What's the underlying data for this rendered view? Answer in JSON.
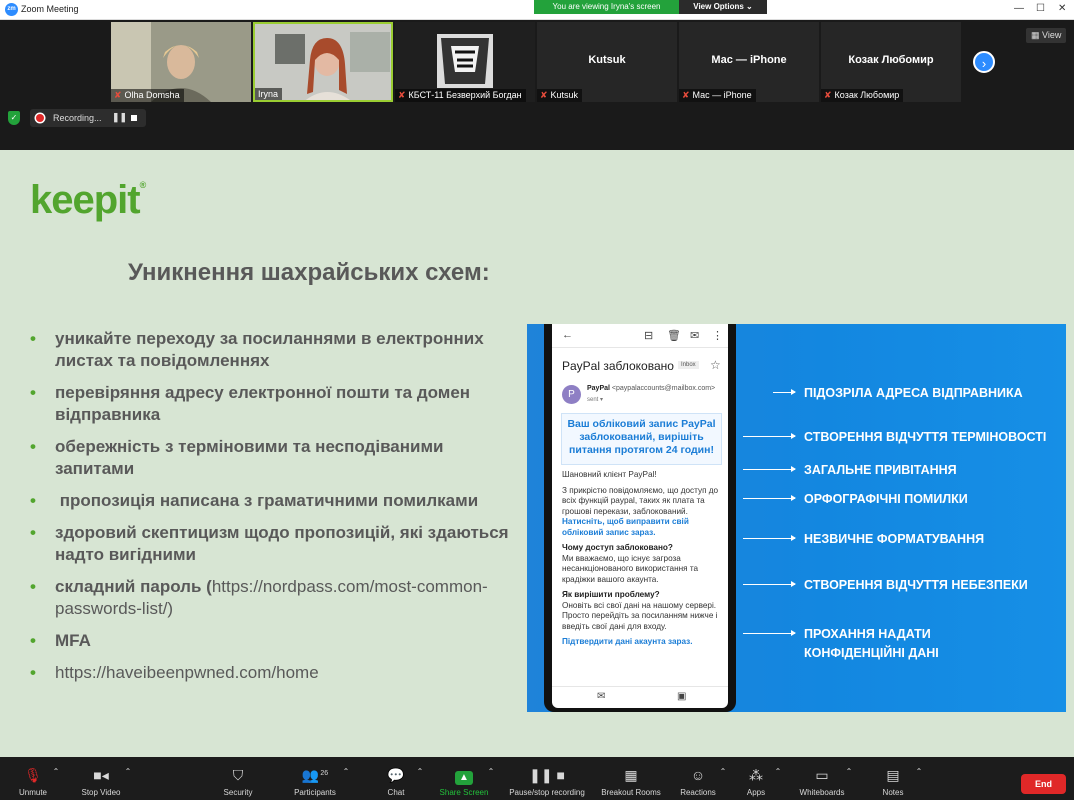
{
  "window": {
    "title": "Zoom Meeting",
    "viewing_banner": "You are viewing Iryna's screen",
    "view_options": "View Options",
    "view_button": "View",
    "recording_label": "Recording..."
  },
  "participants": [
    {
      "name": "Olha Domsha",
      "muted": true,
      "video": true
    },
    {
      "name": "Iryna",
      "muted": false,
      "video": true,
      "active_speaker": true
    },
    {
      "name": "КБСТ-11 Безверхий Богдан",
      "muted": true,
      "video": true
    },
    {
      "name": "Kutsuk",
      "muted": true,
      "video": false
    },
    {
      "name": "Мас — iPhone",
      "muted": true,
      "video": false
    },
    {
      "name": "Козак Любомир",
      "muted": true,
      "video": false
    }
  ],
  "slide": {
    "logo": "keepit",
    "heading": "Уникнення шахрайських схем:",
    "bullets": [
      {
        "text": "уникайте переходу за посиланнями в електронних листах та повідомленнях"
      },
      {
        "text": "перевіряння адресу електронної пошти та домен відправника"
      },
      {
        "text": "обережність з терміновими та несподіваними запитами"
      },
      {
        "text": " пропозиція написана з граматичними помилками"
      },
      {
        "text": "здоровий скептицизм щодо пропозицій, які здаються надто вигідними"
      },
      {
        "text": "складний пароль (",
        "link": "https://nordpass.com/most-common-passwords-list/",
        "tail": ")"
      },
      {
        "text": "MFA"
      },
      {
        "text": "",
        "link": "https://haveibeenpwned.com/home"
      }
    ],
    "email": {
      "subject": "PayPal заблоковано",
      "inbox_tag": "Inbox",
      "sender_name": "PayPal",
      "sender_address": "<paypalaccounts@mailbox.com>",
      "to_line": "sent ▾",
      "avatar_letter": "P",
      "headline": "Ваш обліковий запис PayPal заблокований, вирішіть питання протягом 24 годин!",
      "greeting": "Шановний клієнт PayPal!",
      "para1": "З прикрістю повідомляємо, що доступ до всіх функцій paypal, таких як плата та грошові перекази, заблокований.",
      "link1": "Натисніть, щоб виправити свій обліковий запис зараз.",
      "q1": "Чому доступ заблоковано?",
      "a1": "Ми вважаємо, що існує загроза несанкціонованого використання та крадіжки вашого акаунта.",
      "q2": "Як вирішити проблему?",
      "a2": "Оновіть всі свої дані на нашому сервері. Просто перейдіть за посиланням нижче і введіть свої дані для входу.",
      "link2": "Підтвердити дані акаунта зараз."
    },
    "callouts": [
      "ПІДОЗРІЛА АДРЕСА ВІДПРАВНИКА",
      "СТВОРЕННЯ ВІДЧУТТЯ ТЕРМІНОВОСТІ",
      "ЗАГАЛЬНЕ ПРИВІТАННЯ",
      "ОРФОГРАФІЧНІ ПОМИЛКИ",
      "НЕЗВИЧНЕ ФОРМАТУВАННЯ",
      "СТВОРЕННЯ ВІДЧУТТЯ НЕБЕЗПЕКИ",
      "ПРОХАННЯ НАДАТИ",
      "КОНФІДЕНЦІЙНІ ДАНІ"
    ]
  },
  "toolbar": {
    "unmute": "Unmute",
    "stop_video": "Stop Video",
    "security": "Security",
    "participants": "Participants",
    "participants_count": "26",
    "chat": "Chat",
    "share_screen": "Share Screen",
    "pause_recording": "Pause/stop recording",
    "breakout_rooms": "Breakout Rooms",
    "reactions": "Reactions",
    "apps": "Apps",
    "whiteboards": "Whiteboards",
    "notes": "Notes",
    "end": "End"
  },
  "colors": {
    "brand_green": "#52a52e",
    "slide_bg": "#d7e5d3",
    "zoom_blue": "#2d8cff",
    "share_green": "#23a23b",
    "end_red": "#e02828",
    "infographic_blue": "#1387e0"
  }
}
